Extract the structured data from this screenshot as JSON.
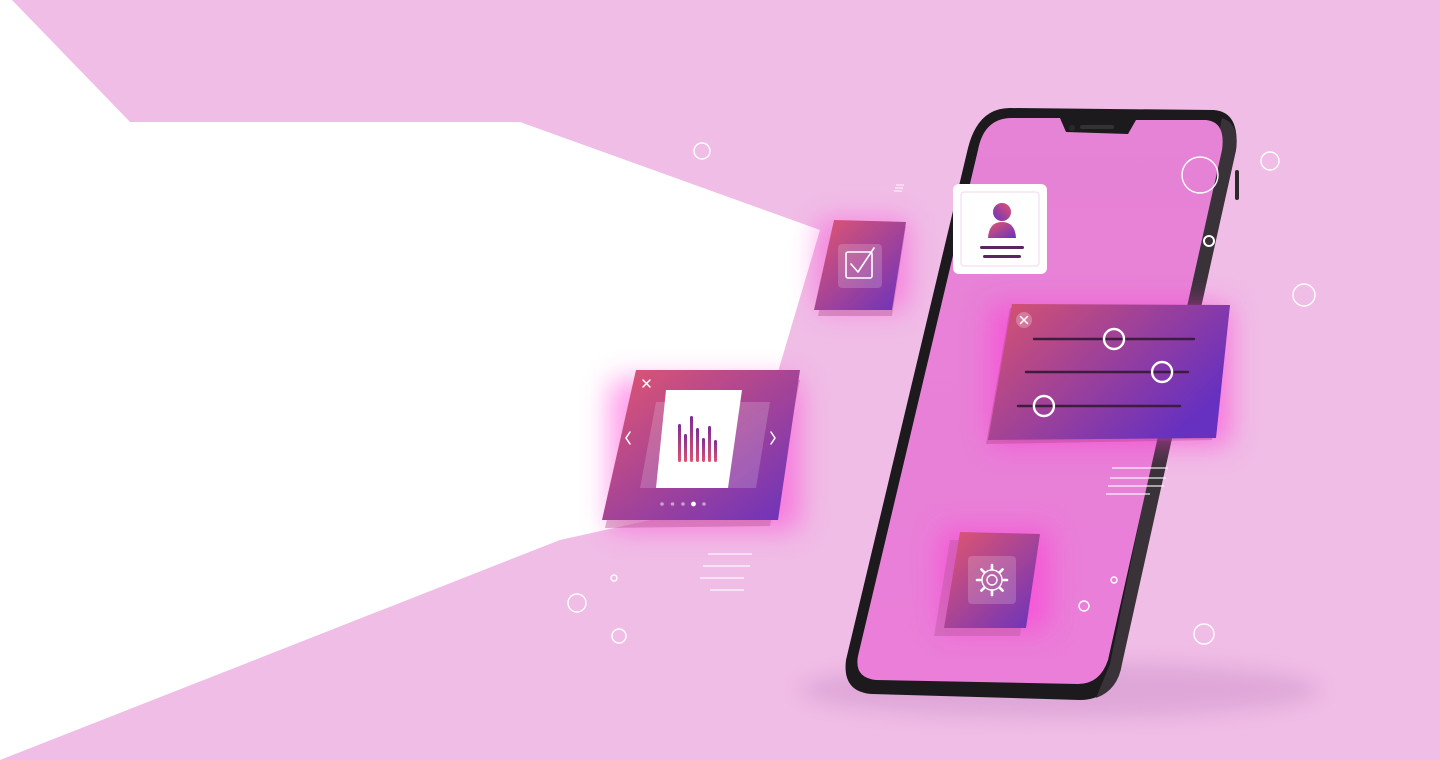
{
  "colors": {
    "background": "#f0bde6",
    "white_panel": "#ffffff",
    "phone_frame": "#1e1b1e",
    "phone_screen": "#e87fd6",
    "card_gradient_start": "#e0506f",
    "card_gradient_end": "#7030b8",
    "glow": "#ff3cd8",
    "accent_dark": "#3d1c3e",
    "line_white": "#ffffff"
  },
  "phone": {
    "profile_card": {
      "icon": "user-icon"
    },
    "settings_tile": {
      "icon": "gear-icon"
    }
  },
  "chart_card": {
    "close_icon": "close-icon",
    "prev_icon": "chevron-left-icon",
    "next_icon": "chevron-right-icon",
    "page_dots": 5,
    "active_dot": 4
  },
  "check_tile": {
    "icon": "checkbox-icon"
  },
  "sliders_card": {
    "close_icon": "close-icon",
    "sliders": [
      {
        "level": 0.5
      },
      {
        "level": 0.84
      },
      {
        "level": 0.16
      }
    ]
  }
}
